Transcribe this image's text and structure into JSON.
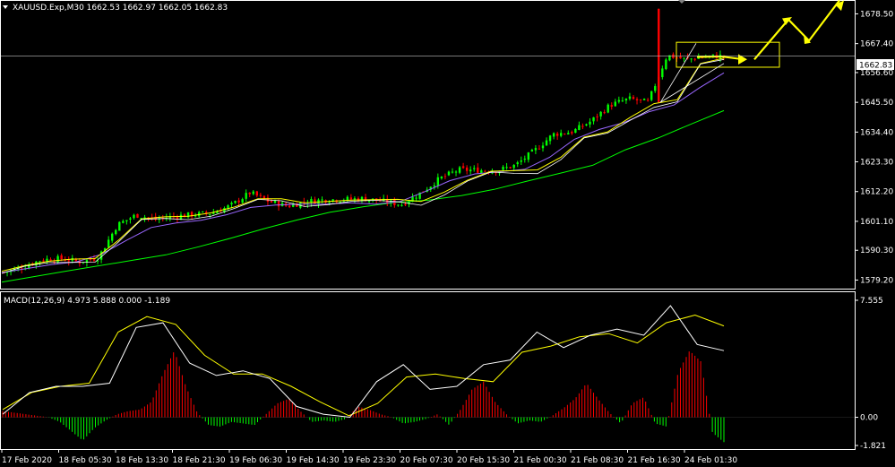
{
  "header": {
    "symbol_line": "XAUUSD.Exp,M30  1662.53 1662.97 1662.05 1662.83",
    "macd_line": "MACD(12,26,9) 4.973 5.888 0.000 -1.189"
  },
  "colors": {
    "background": "#000000",
    "grid_border": "#ffffff",
    "bull_candle": "#00ff00",
    "bear_candle": "#ff0000",
    "ma_fast": "#ffff00",
    "ma_mid": "#ffffff",
    "ma_slow": "#00ff00",
    "ma_purple": "#9966ff",
    "annotation": "#ffff00",
    "macd_hist_pos": "#ff0000",
    "macd_hist_neg": "#00ff00",
    "macd_line": "#ffffff",
    "signal_line": "#ffff00",
    "price_line": "#c0c0c0"
  },
  "chart_data": [
    {
      "type": "candlestick",
      "title": "XAUUSD.Exp,M30",
      "current_price": "1662.83",
      "ylim": [
        1576,
        1683
      ],
      "yticks": [
        "1678.50",
        "1667.40",
        "1656.60",
        "1645.50",
        "1634.40",
        "1623.30",
        "1612.20",
        "1601.10",
        "1590.30",
        "1579.20"
      ],
      "xticks": [
        "17 Feb 2020",
        "18 Feb 05:30",
        "18 Feb 13:30",
        "18 Feb 21:30",
        "19 Feb 06:30",
        "19 Feb 14:30",
        "19 Feb 23:30",
        "20 Feb 07:30",
        "20 Feb 15:30",
        "21 Feb 00:30",
        "21 Feb 08:30",
        "21 Feb 16:30",
        "24 Feb 01:30"
      ],
      "key_closes": [
        1582.0,
        1584.0,
        1586.8,
        1587.2,
        1586.0,
        1587.6,
        1599.8,
        1603.5,
        1601.8,
        1603.0,
        1603.6,
        1604.2,
        1607.0,
        1611.8,
        1608.5,
        1606.8,
        1608.5,
        1609.2,
        1609.3,
        1609.6,
        1608.6,
        1607.4,
        1611.7,
        1617.0,
        1620.3,
        1620.2,
        1620.0,
        1622.0,
        1627.4,
        1633.6,
        1634.5,
        1638.5,
        1644.5,
        1646.8,
        1645.5,
        1663.0,
        1661.5,
        1662.5,
        1662.83
      ],
      "series": [
        {
          "name": "ma_fast",
          "values": [
            1582.5,
            1584.6,
            1586.2,
            1587.0,
            1587.2,
            1594.0,
            1602.0,
            1602.8,
            1603.0,
            1604.3,
            1606.5,
            1609.5,
            1609.5,
            1608.0,
            1608.5,
            1609.0,
            1609.2,
            1609.3,
            1608.5,
            1612.0,
            1616.5,
            1619.8,
            1620.0,
            1620.3,
            1625.0,
            1632.5,
            1634.4,
            1640.0,
            1645.0,
            1646.5,
            1660.0,
            1662.0
          ]
        },
        {
          "name": "ma_purple",
          "values": [
            1582.0,
            1583.5,
            1585.0,
            1586.0,
            1588.8,
            1594.0,
            1598.8,
            1600.5,
            1601.5,
            1603.5,
            1606.3,
            1607.2,
            1607.5,
            1607.5,
            1608.0,
            1607.5,
            1608.5,
            1612.2,
            1616.3,
            1618.8,
            1619.6,
            1620.5,
            1625.0,
            1631.7,
            1635.4,
            1638.0,
            1642.0,
            1644.5,
            1650.8,
            1656.5
          ]
        },
        {
          "name": "ma_slow",
          "values": [
            1578.4,
            1580.5,
            1582.6,
            1584.6,
            1586.6,
            1588.6,
            1591.6,
            1594.9,
            1598.4,
            1601.6,
            1604.5,
            1606.5,
            1608.2,
            1609.0,
            1610.7,
            1613.0,
            1616.1,
            1619.0,
            1622.0,
            1627.8,
            1632.2,
            1637.4,
            1642.4
          ]
        }
      ],
      "annotations": {
        "box_low": 1658.6,
        "box_high": 1667.9,
        "arrow_peak_1": 1676.4,
        "arrow_low": 1668.5,
        "arrow_peak_2": 1683.5
      }
    },
    {
      "type": "macd",
      "ylim": [
        -1.821,
        7.555
      ],
      "yticks": [
        "7.555",
        "0.00",
        "-1.821"
      ],
      "histogram": [
        0.4,
        0.3,
        0.2,
        0.1,
        0.0,
        -0.3,
        -0.9,
        -1.5,
        -0.7,
        -0.2,
        0.2,
        0.4,
        0.5,
        1.0,
        2.8,
        4.3,
        2.0,
        0.3,
        -0.5,
        -0.6,
        -0.3,
        -0.4,
        -0.5,
        0.2,
        0.9,
        1.2,
        0.4,
        -0.3,
        -0.2,
        -0.3,
        -0.1,
        0.7,
        0.5,
        0.2,
        0.0,
        -0.4,
        -0.3,
        -0.1,
        0.2,
        -0.5,
        0.5,
        1.8,
        2.3,
        1.0,
        0.2,
        -0.4,
        -0.2,
        -0.3,
        0.1,
        0.6,
        1.2,
        2.2,
        1.2,
        0.3,
        -0.4,
        0.9,
        1.3,
        -0.4,
        -0.6,
        2.9,
        4.3,
        3.6,
        -1.0,
        -1.6
      ],
      "macd": [
        0.2,
        1.6,
        2.0,
        2.0,
        2.2,
        5.8,
        6.1,
        3.5,
        2.7,
        3.0,
        2.5,
        0.7,
        0.2,
        0.0,
        2.3,
        3.4,
        1.8,
        2.0,
        3.4,
        3.7,
        5.5,
        4.5,
        5.3,
        5.7,
        5.3,
        7.2,
        4.7,
        4.3
      ],
      "signal": [
        0.5,
        1.6,
        2.0,
        2.2,
        5.5,
        6.5,
        6.0,
        4.0,
        2.8,
        2.8,
        2.0,
        1.0,
        0.1,
        0.9,
        2.6,
        2.8,
        2.5,
        2.3,
        4.2,
        4.6,
        5.2,
        5.4,
        4.8,
        6.1,
        6.6,
        5.9
      ]
    }
  ]
}
